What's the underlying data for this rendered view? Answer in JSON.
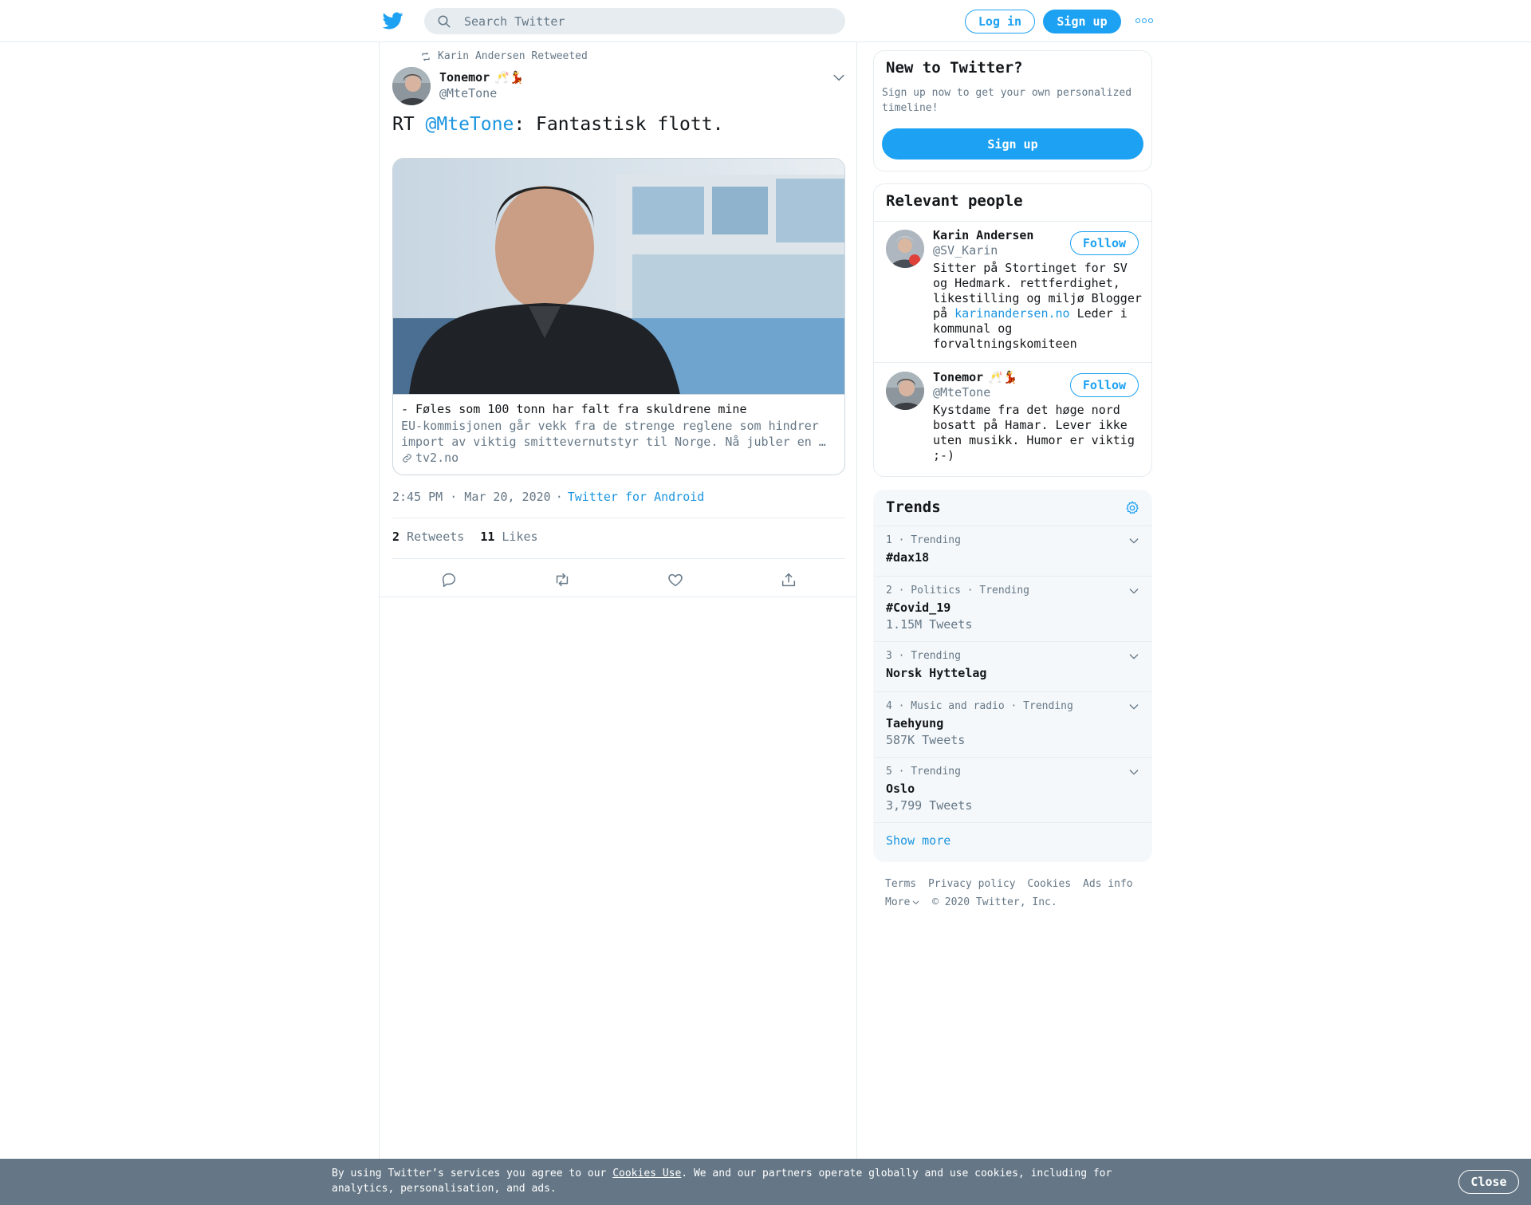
{
  "header": {
    "search_placeholder": "Search Twitter",
    "login_label": "Log in",
    "signup_label": "Sign up",
    "icons": {
      "logo": "twitter-bird-icon",
      "search": "search-icon",
      "more": "more-dots-icon"
    }
  },
  "tweet": {
    "retweeted_by": "Karin Andersen Retweeted",
    "author": {
      "name": "Tonemor",
      "emoji": "🥂💃",
      "handle": "@MteTone"
    },
    "text": {
      "prefix": "RT ",
      "mention": "@MteTone",
      "body": ": Fantastisk flott."
    },
    "card": {
      "title": "- Føles som 100 tonn har falt fra skuldrene mine",
      "description": "EU-kommisjonen går vekk fra de strenge reglene som hindrer import av viktig smittevernutstyr til Norge. Nå jubler en …",
      "domain": "tv2.no"
    },
    "time": "2:45 PM · Mar 20, 2020",
    "separator": "·",
    "source": "Twitter for Android",
    "retweets": {
      "count": "2",
      "label": "Retweets"
    },
    "likes": {
      "count": "11",
      "label": "Likes"
    },
    "actions": [
      "reply-icon",
      "retweet-icon",
      "like-icon",
      "share-icon"
    ]
  },
  "sidebar": {
    "new_to": {
      "title": "New to Twitter?",
      "description": "Sign up now to get your own personalized timeline!",
      "signup_label": "Sign up"
    },
    "relevant": {
      "title": "Relevant people",
      "people": [
        {
          "name": "Karin Andersen",
          "emoji": "",
          "handle": "@SV_Karin",
          "bio_before": "Sitter på Stortinget for SV og Hedmark. rettferdighet, likestilling og miljø Blogger på ",
          "bio_link": "karinandersen.no",
          "bio_after": " Leder i kommunal og forvaltningskomiteen",
          "follow_label": "Follow"
        },
        {
          "name": "Tonemor",
          "emoji": "🥂💃",
          "handle": "@MteTone",
          "bio_before": "Kystdame fra det høge nord bosatt på Hamar. Lever ikke uten musikk. Humor er viktig ;-)",
          "bio_link": "",
          "bio_after": "",
          "follow_label": "Follow"
        }
      ]
    },
    "trends": {
      "title": "Trends",
      "items": [
        {
          "meta": "1 · Trending",
          "name": "#dax18",
          "count": ""
        },
        {
          "meta": "2 · Politics · Trending",
          "name": "#Covid_19",
          "count": "1.15M Tweets"
        },
        {
          "meta": "3 · Trending",
          "name": "Norsk Hyttelag",
          "count": ""
        },
        {
          "meta": "4 · Music and radio · Trending",
          "name": "Taehyung",
          "count": "587K Tweets"
        },
        {
          "meta": "5 · Trending",
          "name": "Oslo",
          "count": "3,799 Tweets"
        }
      ],
      "show_more": "Show more"
    },
    "footer": {
      "links": [
        "Terms",
        "Privacy policy",
        "Cookies",
        "Ads info"
      ],
      "more": "More",
      "copyright": "© 2020 Twitter, Inc."
    }
  },
  "cookie_bar": {
    "text_before": "By using Twitter’s services you agree to our ",
    "link": "Cookies Use",
    "text_after": ". We and our partners operate globally and use cookies, including for analytics, personalisation, and ads.",
    "close_label": "Close"
  },
  "colors": {
    "accent": "#1da1f2",
    "link": "#1b95e0",
    "muted": "#657786",
    "cookie_bg": "#657786"
  }
}
